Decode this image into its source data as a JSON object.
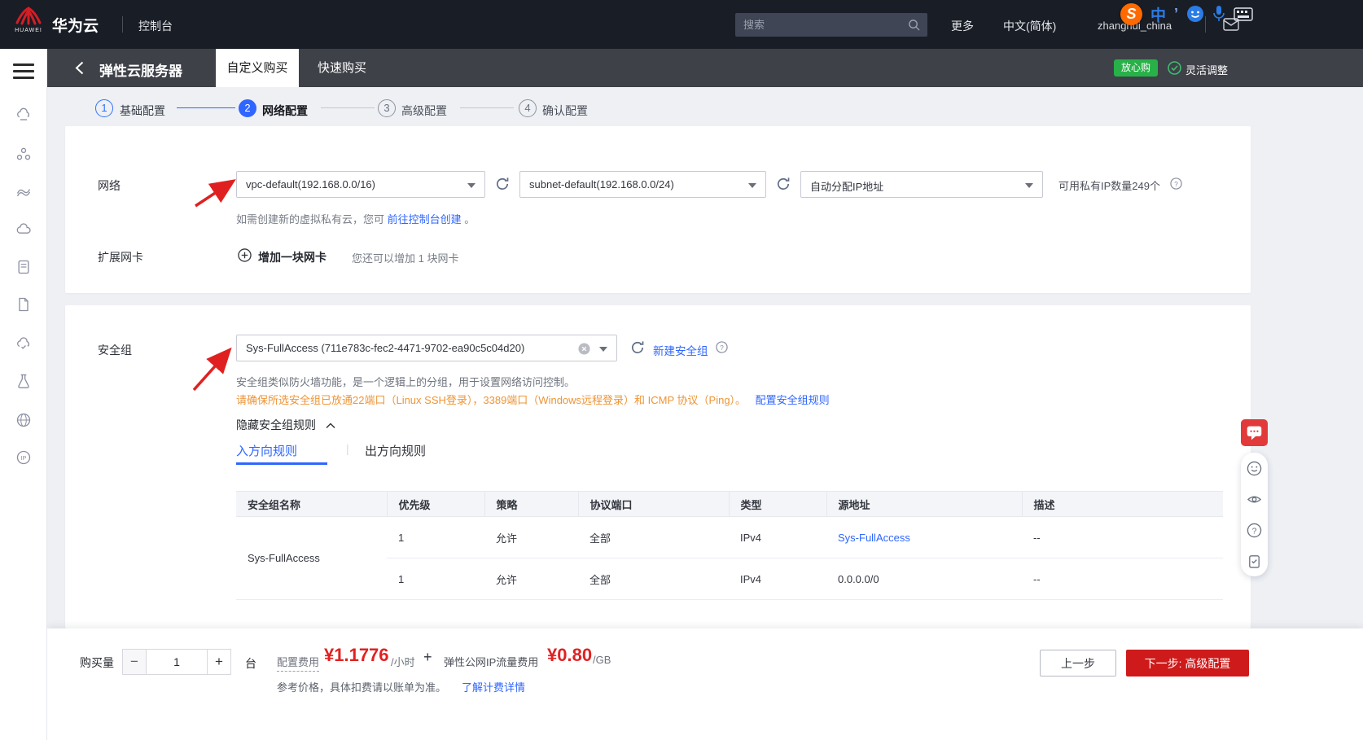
{
  "colors": {
    "accent_blue": "#2f66ff",
    "brand_red": "#d21f26",
    "button_red": "#ce1a1a",
    "price_red": "#e22121",
    "badge_green": "#27b148",
    "warning_orange": "#ee9435"
  },
  "icons": {
    "logo": "huawei-flower",
    "search": "magnifier",
    "refresh": "circular-arrow",
    "help": "question-circle",
    "add": "plus-circle",
    "clear": "x-circle",
    "collapse": "chevron-up",
    "dropdown": "chevron-down"
  },
  "topbar": {
    "brand_text": "华为云",
    "logo_text": "HUAWEI",
    "console": "控制台",
    "search_placeholder": "搜索",
    "more": "更多",
    "language": "中文(简体)",
    "username": "zhanghui_china"
  },
  "ime": {
    "s": "S",
    "zh": "中",
    "comma": "’"
  },
  "nav": {
    "title": "弹性云服务器",
    "tab_custom": "自定义购买",
    "tab_quick": "快速购买",
    "badge": "放心购",
    "flex_adjust": "灵活调整"
  },
  "steps": [
    {
      "num": "1",
      "label": "基础配置",
      "state": "done"
    },
    {
      "num": "2",
      "label": "网络配置",
      "state": "active"
    },
    {
      "num": "3",
      "label": "高级配置",
      "state": "pending"
    },
    {
      "num": "4",
      "label": "确认配置",
      "state": "pending"
    }
  ],
  "network": {
    "label": "网络",
    "vpc_value": "vpc-default(192.168.0.0/16)",
    "subnet_value": "subnet-default(192.168.0.0/24)",
    "ip_value": "自动分配IP地址",
    "ip_hint": "可用私有IP数量249个",
    "help_text": "如需创建新的虚拟私有云，您可",
    "help_link": "前往控制台创建",
    "help_suffix": "。",
    "nic_label": "扩展网卡",
    "add_nic": "增加一块网卡",
    "nic_hint": "您还可以增加 1 块网卡"
  },
  "security": {
    "label": "安全组",
    "sg_value": "Sys-FullAccess (711e783c-fec2-4471-9702-ea90c5c04d20)",
    "new_sg_link": "新建安全组",
    "desc": "安全组类似防火墙功能，是一个逻辑上的分组，用于设置网络访问控制。",
    "warning": "请确保所选安全组已放通22端口（Linux SSH登录），3389端口（Windows远程登录）和 ICMP 协议（Ping）。",
    "warning_link": "配置安全组规则",
    "hide_rules": "隐藏安全组规则",
    "tab_in": "入方向规则",
    "tab_out": "出方向规则",
    "tab_divider": "|",
    "table": {
      "headers": [
        "安全组名称",
        "优先级",
        "策略",
        "协议端口",
        "类型",
        "源地址",
        "描述"
      ],
      "group_name": "Sys-FullAccess",
      "rows": [
        {
          "priority": "1",
          "policy": "允许",
          "port": "全部",
          "type": "IPv4",
          "source": "Sys-FullAccess",
          "desc": "--"
        },
        {
          "priority": "1",
          "policy": "允许",
          "port": "全部",
          "type": "IPv4",
          "source": "0.0.0.0/0",
          "desc": "--"
        }
      ]
    }
  },
  "footer": {
    "qty_label": "购买量",
    "qty_value": "1",
    "minus": "−",
    "plus_btn": "+",
    "unit": "台",
    "fee_label": "配置费用",
    "fee_value": "¥1.1776",
    "fee_unit": "/小时",
    "plus": "+",
    "traffic_label": "弹性公网IP流量费用",
    "traffic_value": "¥0.80",
    "traffic_unit": "/GB",
    "note": "参考价格，具体扣费请以账单为准。",
    "note_link": "了解计费详情",
    "prev_button": "上一步",
    "next_button": "下一步: 高级配置"
  }
}
